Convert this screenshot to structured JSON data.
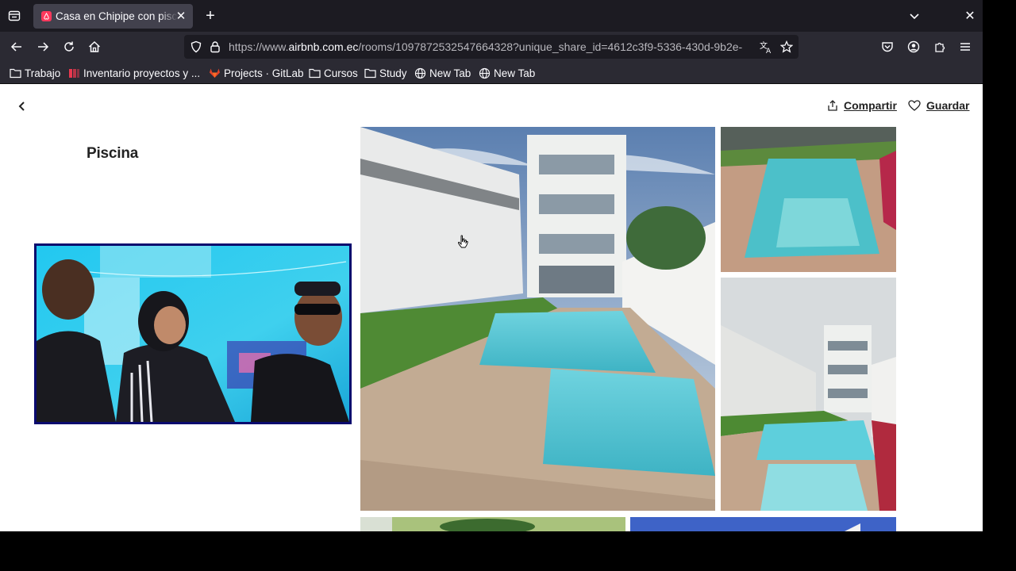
{
  "browser": {
    "tab": {
      "title": "Casa en Chipipe con piscina",
      "close_glyph": "✕"
    },
    "new_tab_glyph": "+",
    "window_close_glyph": "✕",
    "url": {
      "prefix": "https://www.",
      "host": "airbnb.com.ec",
      "path": "/rooms/1097872532547664328?unique_share_id=4612c3f9-5336-430d-9b2e-"
    },
    "bookmarks": [
      {
        "label": "Trabajo",
        "icon": "folder-icon"
      },
      {
        "label": "Inventario proyectos y ...",
        "icon": "sheet-icon"
      },
      {
        "label": "Projects · GitLab",
        "icon": "gitlab-icon"
      },
      {
        "label": "Cursos",
        "icon": "folder-icon"
      },
      {
        "label": "Study",
        "icon": "folder-icon"
      },
      {
        "label": "New Tab",
        "icon": "globe-icon"
      },
      {
        "label": "New Tab",
        "icon": "globe-icon"
      }
    ]
  },
  "page": {
    "share_label": "Compartir",
    "save_label": "Guardar",
    "section_title": "Piscina"
  },
  "colors": {
    "brand": "#ff385c",
    "tabbar_bg": "#1c1b22",
    "toolbar_bg": "#2b2a33",
    "text_dark": "#222222"
  }
}
